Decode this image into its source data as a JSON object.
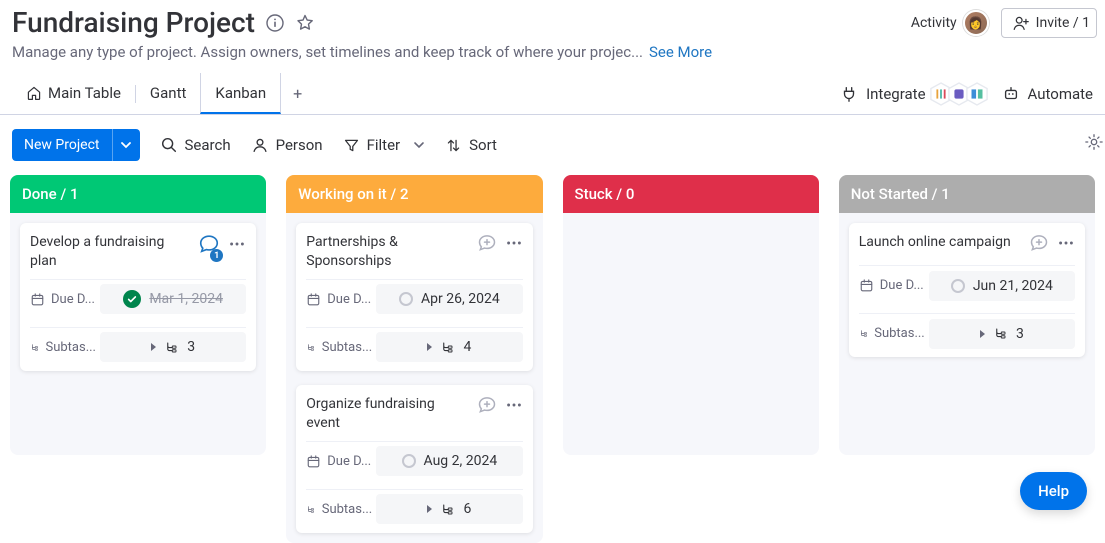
{
  "header": {
    "title": "Fundraising Project",
    "subtitle": "Manage any type of project. Assign owners, set timelines and keep track of where your projec...",
    "see_more": "See More"
  },
  "topRight": {
    "activity": "Activity",
    "invite": "Invite / 1"
  },
  "tabs": {
    "main": "Main Table",
    "gantt": "Gantt",
    "kanban": "Kanban"
  },
  "tabsRight": {
    "integrate": "Integrate",
    "automate": "Automate"
  },
  "toolbar": {
    "newProject": "New Project",
    "search": "Search",
    "person": "Person",
    "filter": "Filter",
    "sort": "Sort"
  },
  "labels": {
    "dueDate": "Due D...",
    "subtasks": "Subtas..."
  },
  "columns": [
    {
      "title": "Done / 1",
      "colorClass": "c-done",
      "cards": [
        {
          "title": "Develop a fundraising plan",
          "date": "Mar 1, 2024",
          "done": true,
          "subtasks": "3",
          "chatBadge": true
        }
      ]
    },
    {
      "title": "Working on it / 2",
      "colorClass": "c-work",
      "cards": [
        {
          "title": "Partnerships & Sponsorships",
          "date": "Apr 26, 2024",
          "done": false,
          "subtasks": "4",
          "chatBadge": false
        },
        {
          "title": "Organize fundraising event",
          "date": "Aug 2, 2024",
          "done": false,
          "subtasks": "6",
          "chatBadge": false
        }
      ]
    },
    {
      "title": "Stuck / 0",
      "colorClass": "c-stuck",
      "cards": []
    },
    {
      "title": "Not Started / 1",
      "colorClass": "c-not",
      "cards": [
        {
          "title": "Launch online campaign",
          "date": "Jun 21, 2024",
          "done": false,
          "subtasks": "3",
          "chatBadge": false
        }
      ]
    }
  ],
  "help": "Help"
}
